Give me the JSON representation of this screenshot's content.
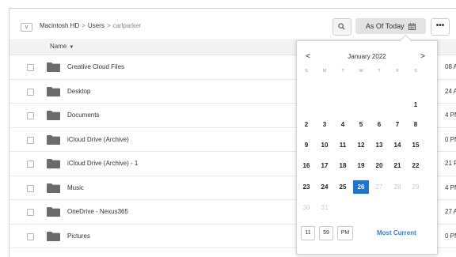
{
  "breadcrumb": {
    "toggle": "v",
    "items": [
      "Macintosh HD",
      "Users",
      "carlparker"
    ],
    "separator": ">"
  },
  "toolbar": {
    "as_of_label": "As Of Today",
    "more_label": "•••"
  },
  "table": {
    "name_header": "Name",
    "date_header_partial": "d",
    "rows": [
      {
        "name": "Creative Cloud Files",
        "time": "08 AM"
      },
      {
        "name": "Desktop",
        "time": "24 AM"
      },
      {
        "name": "Documents",
        "time": "4 PM"
      },
      {
        "name": "iCloud Drive (Archive)",
        "time": "0 PM"
      },
      {
        "name": "iCloud Drive (Archive) - 1",
        "time": "21 PM"
      },
      {
        "name": "Music",
        "time": "4 PM"
      },
      {
        "name": "OneDrive - Nexus365",
        "time": "27 AM"
      },
      {
        "name": "Pictures",
        "time": "0 PM"
      }
    ]
  },
  "calendar": {
    "month_label": "January 2022",
    "prev": "<",
    "next": ">",
    "weekdays": [
      "S",
      "M",
      "T",
      "W",
      "T",
      "F",
      "S"
    ],
    "weeks": [
      [
        null,
        null,
        null,
        null,
        null,
        null,
        "1"
      ],
      [
        "2",
        "3",
        "4",
        "5",
        "6",
        "7",
        "8"
      ],
      [
        "9",
        "10",
        "11",
        "12",
        "13",
        "14",
        "15"
      ],
      [
        "16",
        "17",
        "18",
        "19",
        "20",
        "21",
        "22"
      ],
      [
        "23",
        "24",
        "25",
        "26",
        "27",
        "28",
        "29"
      ],
      [
        "30",
        "31",
        null,
        null,
        null,
        null,
        null
      ]
    ],
    "selected_day": "26",
    "disabled_days": [
      "27",
      "28",
      "29",
      "30",
      "31"
    ],
    "hour": "11",
    "minute": "59",
    "ampm": "PM",
    "most_current_label": "Most Current",
    "selected_color": "#1d74d8"
  }
}
